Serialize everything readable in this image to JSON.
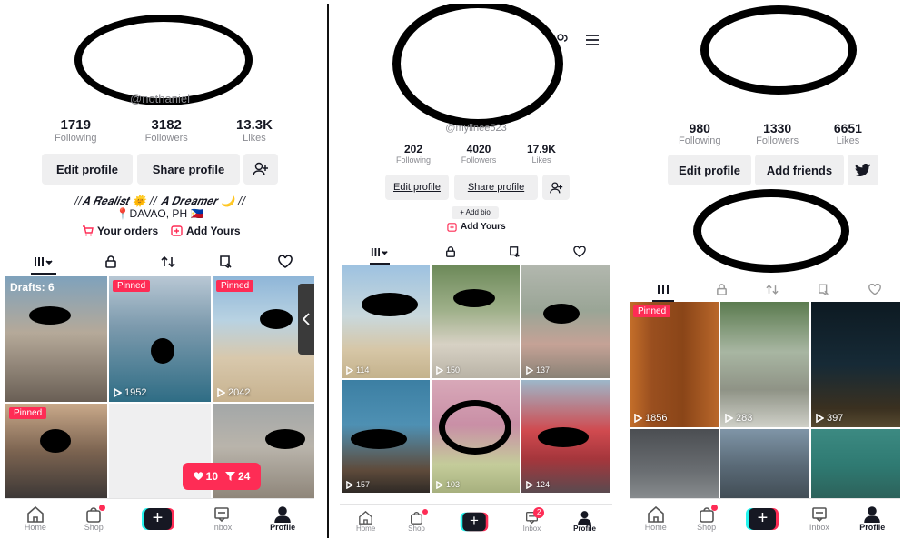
{
  "colors": {
    "accent": "#fe2c55",
    "cyan": "#25f4ee",
    "text": "#161823",
    "muted": "#8a8b91",
    "button_bg": "#efeff0"
  },
  "panel1": {
    "username": "@nothaniel",
    "stats": [
      {
        "value": "1719",
        "label": "Following"
      },
      {
        "value": "3182",
        "label": "Followers"
      },
      {
        "value": "13.3K",
        "label": "Likes"
      }
    ],
    "edit_profile": "Edit profile",
    "share_profile": "Share profile",
    "bio_line1": "//𝑨 𝑹𝒆𝒂𝒍𝒊𝒔𝒕 🌞 // 𝑨 𝑫𝒓𝒆𝒂𝒎𝒆𝒓 🌙 //",
    "bio_line2": "📍DAVAO, PH 🇵🇭",
    "your_orders": "Your orders",
    "add_yours": "Add Yours",
    "drafts": "Drafts: 6",
    "videos": [
      {
        "pinned": "",
        "views": ""
      },
      {
        "pinned": "Pinned",
        "views": "1952"
      },
      {
        "pinned": "Pinned",
        "views": "2042"
      },
      {
        "pinned": "Pinned",
        "views": ""
      },
      {
        "pinned": "",
        "views": ""
      },
      {
        "pinned": "",
        "views": ""
      }
    ],
    "popup_likes": "10",
    "popup_followers": "24"
  },
  "panel2": {
    "username": "@mylinee523",
    "stats": [
      {
        "value": "202",
        "label": "Following"
      },
      {
        "value": "4020",
        "label": "Followers"
      },
      {
        "value": "17.9K",
        "label": "Likes"
      }
    ],
    "edit_profile": "Edit profile",
    "share_profile": "Share profile",
    "add_bio": "+ Add bio",
    "add_yours": "Add Yours",
    "videos": [
      {
        "views": "114"
      },
      {
        "views": "150"
      },
      {
        "views": "137"
      },
      {
        "views": "157"
      },
      {
        "views": "103"
      },
      {
        "views": "124"
      }
    ]
  },
  "panel3": {
    "stats": [
      {
        "value": "980",
        "label": "Following"
      },
      {
        "value": "1330",
        "label": "Followers"
      },
      {
        "value": "6651",
        "label": "Likes"
      }
    ],
    "edit_profile": "Edit profile",
    "add_friends": "Add friends",
    "pinned_label": "Pinned",
    "videos": [
      {
        "views": "1856"
      },
      {
        "views": "283"
      },
      {
        "views": "397"
      },
      {
        "views": ""
      },
      {
        "views": ""
      },
      {
        "views": ""
      }
    ]
  },
  "nav": {
    "home": "Home",
    "shop": "Shop",
    "inbox": "Inbox",
    "profile": "Profile",
    "inbox_badge_p2": "2"
  }
}
